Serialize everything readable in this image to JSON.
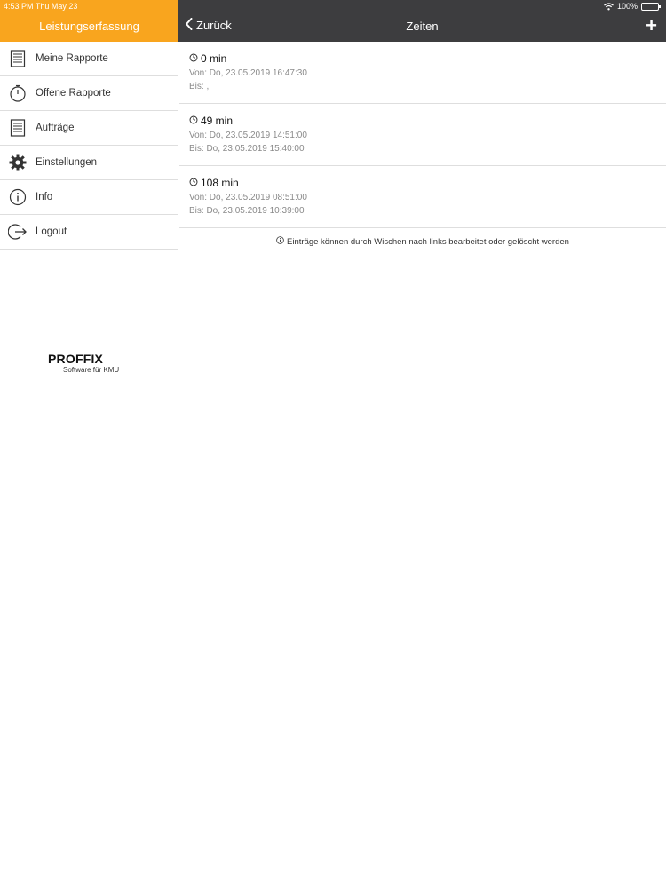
{
  "status_bar": {
    "time": "4:53 PM   Thu May 23",
    "battery": "100%"
  },
  "sidebar": {
    "title": "Leistungserfassung",
    "items": [
      {
        "label": "Meine Rapporte",
        "icon": "document-list-icon"
      },
      {
        "label": "Offene Rapporte",
        "icon": "stopwatch-icon"
      },
      {
        "label": "Aufträge",
        "icon": "document-list-icon"
      },
      {
        "label": "Einstellungen",
        "icon": "gear-icon"
      },
      {
        "label": "Info",
        "icon": "info-icon"
      },
      {
        "label": "Logout",
        "icon": "logout-icon"
      }
    ],
    "logo": {
      "name": "PROFFIX",
      "tagline": "Software für KMU"
    }
  },
  "header": {
    "back_label": "Zurück",
    "title": "Zeiten",
    "add_label": "+"
  },
  "entries": [
    {
      "duration": "0 min",
      "from": "Von: Do, 23.05.2019 16:47:30",
      "to": "Bis: ,"
    },
    {
      "duration": "49 min",
      "from": "Von: Do, 23.05.2019 14:51:00",
      "to": "Bis: Do, 23.05.2019 15:40:00"
    },
    {
      "duration": "108 min",
      "from": "Von: Do, 23.05.2019 08:51:00",
      "to": "Bis: Do, 23.05.2019 10:39:00"
    }
  ],
  "hint": "Einträge können durch Wischen nach links bearbeitet oder gelöscht werden",
  "colors": {
    "accent": "#f9a51e",
    "header_dark": "#3d3d3f"
  }
}
